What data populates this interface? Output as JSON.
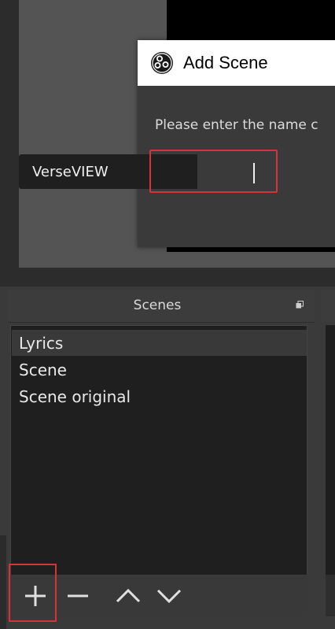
{
  "dialog": {
    "title": "Add Scene",
    "prompt": "Please enter the name c",
    "input_value": "VerseVIEW"
  },
  "scenes_dock": {
    "title": "Scenes",
    "items": [
      {
        "label": "Lyrics",
        "selected": true
      },
      {
        "label": "Scene",
        "selected": false
      },
      {
        "label": "Scene original",
        "selected": false
      }
    ],
    "toolbar": {
      "add": "add-icon",
      "remove": "remove-icon",
      "up": "chevron-up-icon",
      "down": "chevron-down-icon"
    }
  },
  "colors": {
    "highlight": "#d8313a",
    "dialog_bg": "#3a3a3a",
    "list_bg": "#1f1f1f"
  }
}
